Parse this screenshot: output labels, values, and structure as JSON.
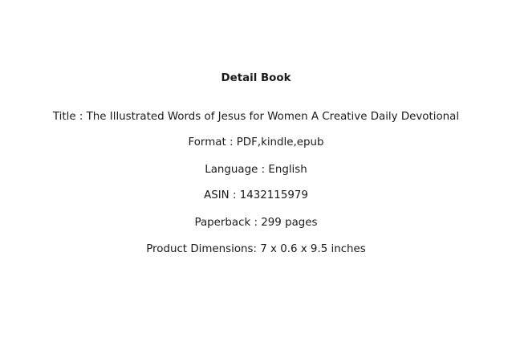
{
  "document": {
    "heading": "Detail Book",
    "lines": [
      "Title : The Illustrated Words of Jesus for Women A Creative Daily Devotional",
      "Format : PDF,kindle,epub",
      "Language : English",
      "ASIN : 1432115979",
      "Paperback : 299 pages",
      "Product Dimensions: 7 x 0.6 x 9.5 inches"
    ]
  }
}
